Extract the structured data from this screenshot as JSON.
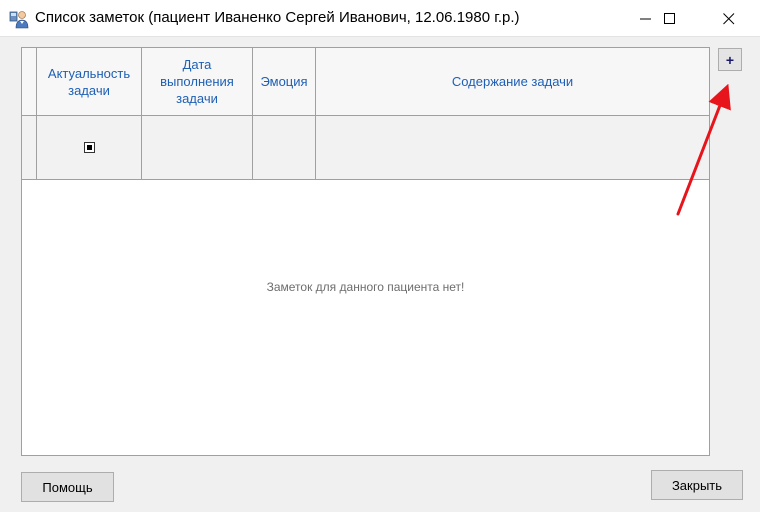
{
  "window": {
    "title": "Список заметок (пациент Иваненко Сергей Иванович, 12.06.1980 г.р.)",
    "icon": "app-user-icon",
    "controls": [
      "minimize-icon",
      "maximize-icon",
      "close-icon"
    ]
  },
  "grid": {
    "columns": [
      {
        "label": "Актуальность задачи"
      },
      {
        "label": "Дата выполнения задачи"
      },
      {
        "label": "Эмоция"
      },
      {
        "label": "Содержание задачи"
      }
    ],
    "new_row": {
      "relevance_checked": true,
      "date": "",
      "emotion": "",
      "content": ""
    },
    "empty_message": "Заметок для данного пациента нет!"
  },
  "toolbar": {
    "add_label": "+"
  },
  "annotation": {
    "arrow_color": "#e8141b"
  },
  "footer": {
    "help_label": "Помощь",
    "close_label": "Закрыть"
  },
  "colors": {
    "header_text": "#1e5fb4",
    "grid_border": "#a0a0a0"
  }
}
